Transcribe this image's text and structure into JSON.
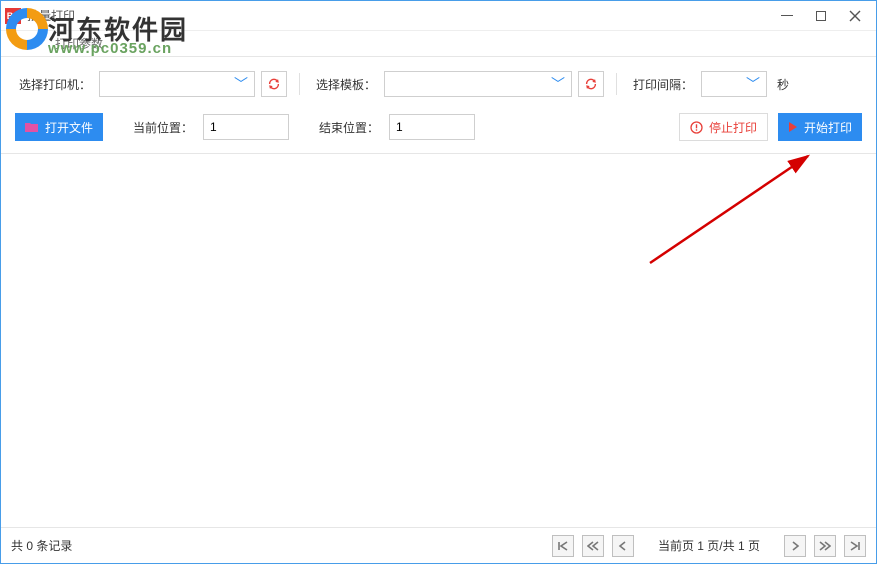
{
  "titlebar": {
    "title": "批量打印",
    "app_icon_text": "BS"
  },
  "subbar": {
    "label": "打印参数"
  },
  "row1": {
    "printer_label": "选择打印机：",
    "printer_value": "",
    "template_label": "选择模板：",
    "template_value": "",
    "interval_label": "打印间隔：",
    "interval_value": "",
    "interval_unit": "秒"
  },
  "row2": {
    "open_file_label": "打开文件",
    "current_pos_label": "当前位置：",
    "current_pos_value": "1",
    "end_pos_label": "结束位置：",
    "end_pos_value": "1",
    "stop_label": "停止打印",
    "start_label": "开始打印"
  },
  "status": {
    "record_prefix": "共",
    "record_count": "0",
    "record_suffix": "条记录",
    "page_text": "当前页 1 页/共 1 页"
  },
  "watermark": {
    "line1": "河东软件园",
    "line2": "www.pc0359.cn"
  }
}
